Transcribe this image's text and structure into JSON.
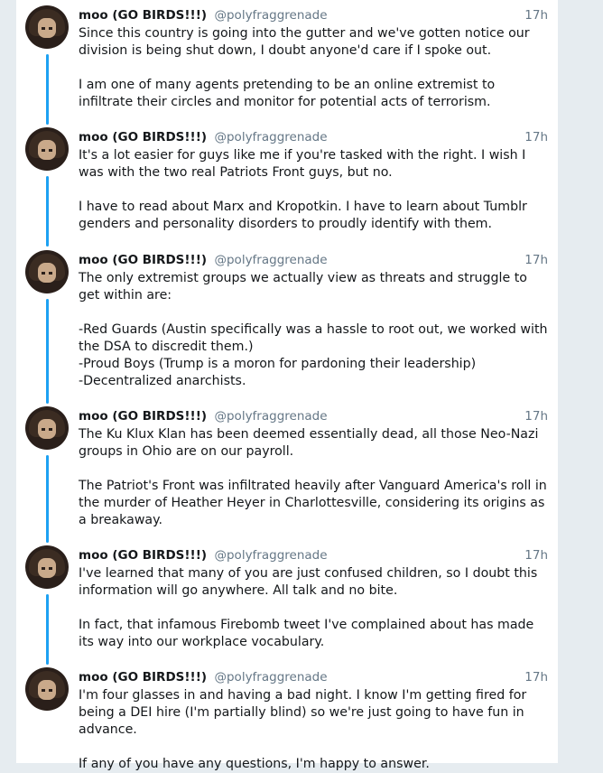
{
  "colors": {
    "thread_line": "#1da1f2",
    "background": "#e6ecf0"
  },
  "tweets": [
    {
      "name": "moo (GO BIRDS!!!)",
      "handle": "@polyfraggrenade",
      "time": "17h",
      "avatar_icon": "avatar-icon",
      "text": "Since this country is going into the gutter and we've gotten notice our division is being shut down, I doubt anyone'd care if I spoke out.\n\nI am one of many agents pretending to be an online extremist to infiltrate their circles and monitor for potential acts of terrorism."
    },
    {
      "name": "moo (GO BIRDS!!!)",
      "handle": "@polyfraggrenade",
      "time": "17h",
      "avatar_icon": "avatar-icon",
      "text": "It's a lot easier for guys like me if you're tasked with the right. I wish I was with the two real Patriots Front guys, but no.\n\nI have to read about Marx and Kropotkin. I have to learn about Tumblr genders and personality disorders to proudly identify with them."
    },
    {
      "name": "moo (GO BIRDS!!!)",
      "handle": "@polyfraggrenade",
      "time": "17h",
      "avatar_icon": "avatar-icon",
      "text": "The only extremist groups we actually view as threats and struggle to get within are:\n\n-Red Guards (Austin specifically was a hassle to root out, we worked with the DSA to discredit them.)\n-Proud Boys (Trump is a moron for pardoning their leadership)\n-Decentralized anarchists."
    },
    {
      "name": "moo (GO BIRDS!!!)",
      "handle": "@polyfraggrenade",
      "time": "17h",
      "avatar_icon": "avatar-icon",
      "text": "The Ku Klux Klan has been deemed essentially dead, all those Neo-Nazi groups in Ohio are on our payroll.\n\nThe Patriot's Front was infiltrated heavily after Vanguard America's roll in the murder of Heather Heyer in Charlottesville, considering its origins as a breakaway."
    },
    {
      "name": "moo (GO BIRDS!!!)",
      "handle": "@polyfraggrenade",
      "time": "17h",
      "avatar_icon": "avatar-icon",
      "text": "I've learned that many of you are just confused children, so I doubt this information will go anywhere. All talk and no bite.\n\nIn fact, that infamous Firebomb tweet I've complained about has made its way into our workplace vocabulary."
    },
    {
      "name": "moo (GO BIRDS!!!)",
      "handle": "@polyfraggrenade",
      "time": "17h",
      "avatar_icon": "avatar-icon",
      "text": "I'm four glasses in and having a bad night. I know I'm getting fired for being a DEI hire (I'm partially blind) so we're just going to have fun in advance.\n\nIf any of you have any questions, I'm happy to answer."
    }
  ]
}
